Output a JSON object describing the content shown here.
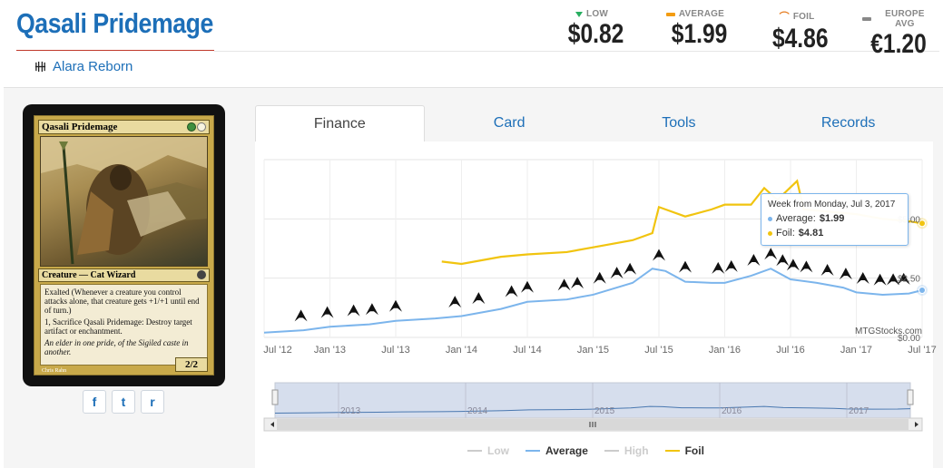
{
  "card": {
    "title": "Qasali Pridemage",
    "set_name": "Alara Reborn",
    "name_on_card": "Qasali Pridemage",
    "type_line": "Creature — Cat Wizard",
    "rules_1": "Exalted (Whenever a creature you control attacks alone, that creature gets +1/+1 until end of turn.)",
    "rules_2": "1, Sacrifice Qasali Pridemage: Destroy target artifact or enchantment.",
    "flavor": "An elder in one pride, of the Sigiled caste in another.",
    "pt": "2/2",
    "artist": "Chris Rahn"
  },
  "prices": {
    "low": {
      "label": "LOW",
      "value": "$0.82",
      "color": "#27ae60"
    },
    "average": {
      "label": "AVERAGE",
      "value": "$1.99",
      "color": "#f39c12"
    },
    "foil": {
      "label": "FOIL",
      "value": "$4.86",
      "color": "#e67e22"
    },
    "europe": {
      "label": "EUROPE AVG",
      "value": "€1.20",
      "color": "#888888"
    }
  },
  "social": {
    "facebook": "f",
    "twitter": "t",
    "reddit": "r"
  },
  "tabs": [
    "Finance",
    "Card",
    "Tools",
    "Records"
  ],
  "tooltip": {
    "header": "Week from Monday, Jul 3, 2017",
    "average_label": "Average:",
    "average_value": "$1.99",
    "foil_label": "Foil:",
    "foil_value": "$4.81"
  },
  "watermark": "MTGStocks.com",
  "legend": [
    {
      "name": "Low",
      "color": "#cccccc",
      "active": false
    },
    {
      "name": "Average",
      "color": "#7cb5ec",
      "active": true
    },
    {
      "name": "High",
      "color": "#cccccc",
      "active": false
    },
    {
      "name": "Foil",
      "color": "#f1c40f",
      "active": true
    }
  ],
  "chart_data": {
    "type": "line",
    "x_tick_labels": [
      "Jul '12",
      "Jan '13",
      "Jul '13",
      "Jan '14",
      "Jul '14",
      "Jan '15",
      "Jul '15",
      "Jan '16",
      "Jul '16",
      "Jan '17",
      "Jul '17"
    ],
    "y_tick_labels": [
      "$5.00",
      "$2.50",
      "$0.00"
    ],
    "ylim": [
      0,
      7.5
    ],
    "navigator_labels": [
      "2013",
      "2014",
      "2015",
      "2016",
      "2017"
    ],
    "series": [
      {
        "name": "Average",
        "color": "#7cb5ec",
        "x": [
          2012.5,
          2012.8,
          2013.0,
          2013.3,
          2013.5,
          2013.8,
          2014.0,
          2014.3,
          2014.5,
          2014.8,
          2015.0,
          2015.3,
          2015.45,
          2015.55,
          2015.7,
          2015.9,
          2016.0,
          2016.2,
          2016.35,
          2016.5,
          2016.7,
          2016.9,
          2017.0,
          2017.2,
          2017.4,
          2017.5
        ],
        "values": [
          0.2,
          0.3,
          0.45,
          0.55,
          0.7,
          0.8,
          0.9,
          1.2,
          1.5,
          1.6,
          1.8,
          2.3,
          2.9,
          2.8,
          2.35,
          2.3,
          2.3,
          2.6,
          2.9,
          2.45,
          2.3,
          2.1,
          1.9,
          1.8,
          1.85,
          1.99
        ]
      },
      {
        "name": "Foil",
        "color": "#f1c40f",
        "x": [
          2013.85,
          2014.0,
          2014.3,
          2014.5,
          2014.8,
          2015.0,
          2015.3,
          2015.45,
          2015.5,
          2015.7,
          2015.9,
          2016.0,
          2016.2,
          2016.3,
          2016.4,
          2016.55,
          2016.6,
          2016.8,
          2017.0,
          2017.2,
          2017.4,
          2017.5
        ],
        "values": [
          3.2,
          3.1,
          3.4,
          3.5,
          3.6,
          3.8,
          4.1,
          4.4,
          5.5,
          5.1,
          5.4,
          5.6,
          5.6,
          6.3,
          5.8,
          6.6,
          5.4,
          5.3,
          5.2,
          5.0,
          4.9,
          4.81
        ]
      }
    ],
    "grid": true
  }
}
